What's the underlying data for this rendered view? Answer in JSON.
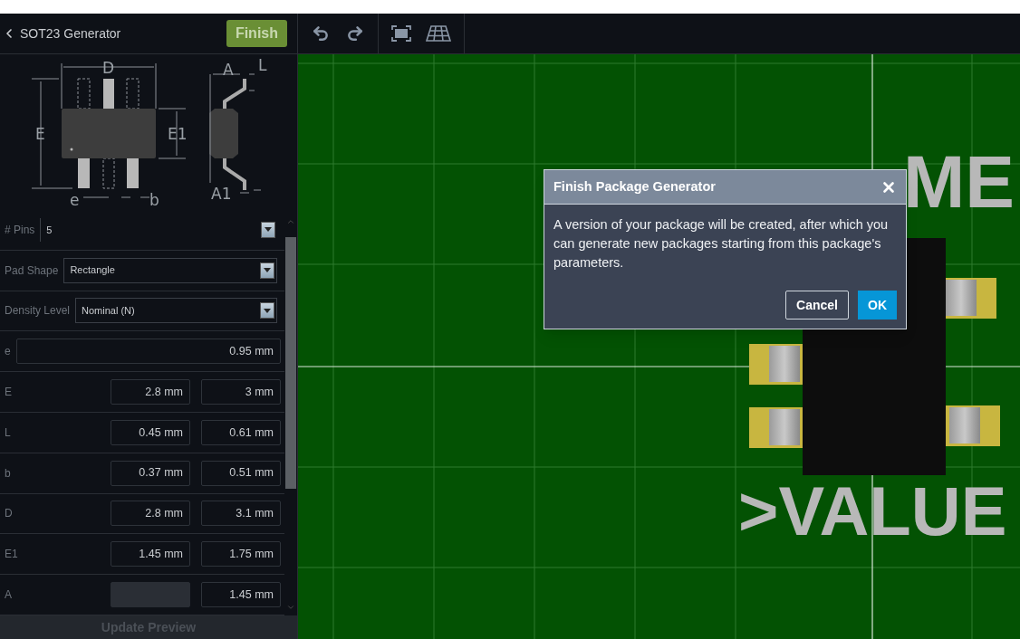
{
  "header": {
    "title": "SOT23 Generator",
    "finish_button": "Finish"
  },
  "diagram_labels": {
    "d": "D",
    "e_span": "E",
    "e1": "E1",
    "pitch": "e",
    "b": "b",
    "a": "A",
    "l": "L",
    "a1": "A1"
  },
  "selects": [
    {
      "label": "# Pins",
      "value": "5",
      "kind": "compact"
    },
    {
      "label": "Pad Shape",
      "value": "Rectangle",
      "kind": "wide"
    },
    {
      "label": "Density Level",
      "value": "Nominal (N)",
      "kind": "wide"
    }
  ],
  "params": [
    {
      "label": "e",
      "kind": "single",
      "fields": [
        {
          "value": "0.95 mm",
          "disabled": false
        }
      ]
    },
    {
      "label": "E",
      "kind": "range",
      "fields": [
        {
          "value": "2.8 mm",
          "disabled": false
        },
        {
          "value": "3 mm",
          "disabled": false
        }
      ]
    },
    {
      "label": "L",
      "kind": "range",
      "fields": [
        {
          "value": "0.45 mm",
          "disabled": false
        },
        {
          "value": "0.61 mm",
          "disabled": false
        }
      ]
    },
    {
      "label": "b",
      "kind": "range",
      "fields": [
        {
          "value": "0.37 mm",
          "disabled": false
        },
        {
          "value": "0.51 mm",
          "disabled": false
        }
      ]
    },
    {
      "label": "D",
      "kind": "range",
      "fields": [
        {
          "value": "2.8 mm",
          "disabled": false
        },
        {
          "value": "3.1 mm",
          "disabled": false
        }
      ]
    },
    {
      "label": "E1",
      "kind": "range",
      "fields": [
        {
          "value": "1.45 mm",
          "disabled": false
        },
        {
          "value": "1.75 mm",
          "disabled": false
        }
      ]
    },
    {
      "label": "A",
      "kind": "range",
      "fields": [
        {
          "disabled": true
        },
        {
          "value": "1.45 mm",
          "disabled": false
        }
      ]
    }
  ],
  "update_button": {
    "label": "Update Preview",
    "disabled": true
  },
  "canvas": {
    "name_text": "ME",
    "value_text": ">VALUE"
  },
  "dialog": {
    "title": "Finish Package Generator",
    "body": "A version of your package will be created, after which you can generate new packages starting from this package's parameters.",
    "buttons": [
      {
        "label": "Cancel",
        "kind": "secondary"
      },
      {
        "label": "OK",
        "kind": "primary"
      }
    ]
  }
}
